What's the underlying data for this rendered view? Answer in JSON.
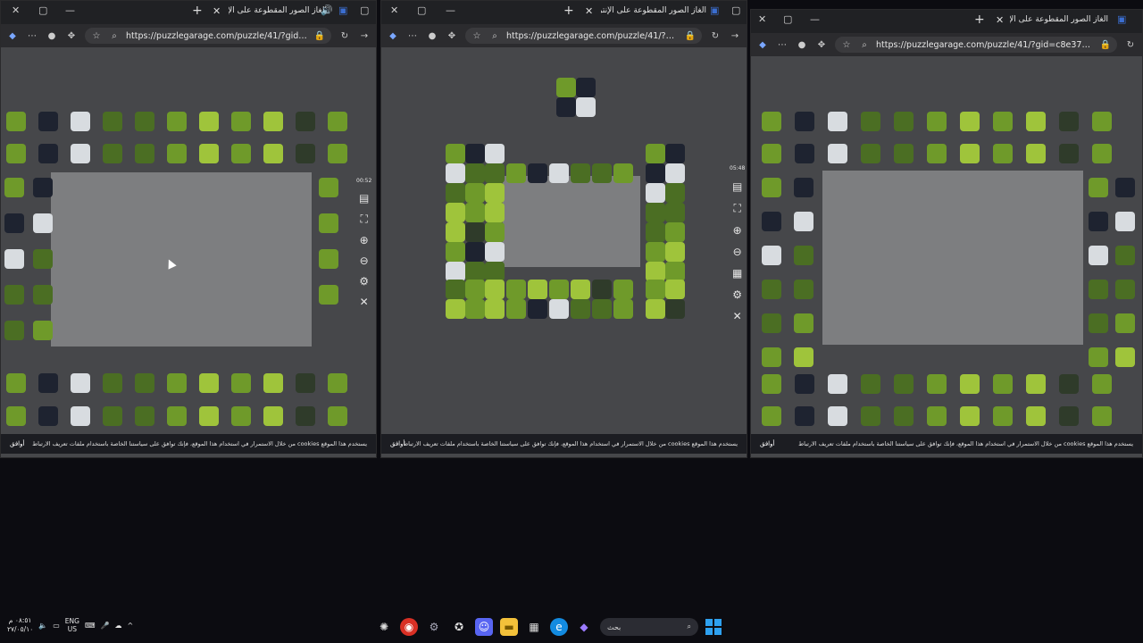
{
  "windows": [
    {
      "tab_title": "ألغاز الصور المقطوعة على الإنترنت",
      "url": "https://puzzlegarage.com/puzzle/41/?gid=1a...",
      "timer": "00:52",
      "cookie_text": "يستخدم هذا الموقع cookies من خلال الاستمرار في استخدام هذا الموقع، فإنك توافق على سياستنا الخاصة باستخدام ملفات تعريف الارتباط",
      "cookie_link": "cookies",
      "cookie_ok": "أوافق"
    },
    {
      "tab_title": "ألغاز الصور المقطوعة على الإنترنت",
      "url": "https://puzzlegarage.com/puzzle/41/?gid=e...",
      "timer": "05:48",
      "cookie_text": "يستخدم هذا الموقع cookies من خلال الاستمرار في استخدام هذا الموقع، فإنك توافق على سياستنا الخاصة باستخدام ملفات تعريف الارتباط",
      "cookie_link": "cookies",
      "cookie_ok": "أوافق"
    },
    {
      "tab_title": "ألغاز الصور المقطوعة على الإنترنت",
      "url": "https://puzzlegarage.com/puzzle/41/?gid=c8e37b5cad...",
      "timer": "",
      "cookie_text": "يستخدم هذا الموقع cookies من خلال الاستمرار في استخدام هذا الموقع، فإنك توافق على سياستنا الخاصة باستخدام ملفات تعريف الارتباط",
      "cookie_link": "cookies",
      "cookie_ok": "أوافق"
    }
  ],
  "toolbar_icons": [
    "copilot-icon",
    "more-icon",
    "profile-icon",
    "puzzle-extension-icon",
    "favorite-icon",
    "search-icon",
    "lock-icon",
    "reload-icon",
    "forward-icon"
  ],
  "tool_icons": [
    "image-preview-icon",
    "fullscreen-icon",
    "zoom-in-icon",
    "zoom-out-icon",
    "grid-icon",
    "settings-icon",
    "close-icon"
  ],
  "taskbar": {
    "time": "٠٨:٥١ م",
    "date": "٢٧/٠٥/١٠",
    "lang_top": "ENG",
    "lang_bottom": "US",
    "search_placeholder": "بحث",
    "apps": [
      "settings-gear-icon",
      "chrome-icon",
      "gear-icon",
      "chatgpt-icon",
      "discord-icon",
      "file-explorer-icon",
      "store-icon",
      "edge-icon",
      "copilot-icon"
    ]
  },
  "colors": {
    "accent": "#2ea1f0",
    "board": "#7d7e80",
    "workspace": "#46474a",
    "titlebar": "#202124"
  }
}
